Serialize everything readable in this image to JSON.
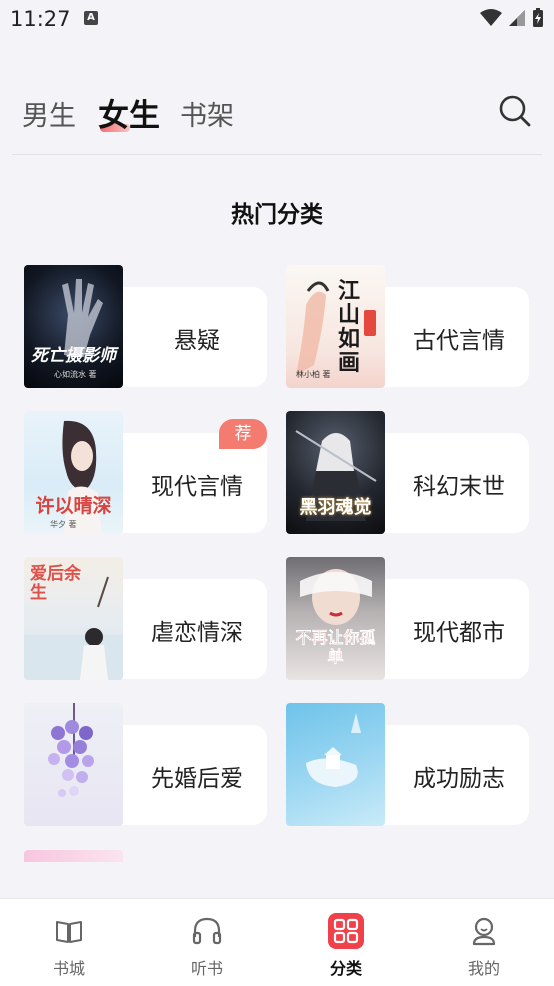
{
  "status_bar": {
    "time": "11:27",
    "notification_icon": "A"
  },
  "top_tabs": [
    {
      "label": "男生",
      "active": false
    },
    {
      "label": "女生",
      "active": true
    },
    {
      "label": "书架",
      "active": false
    }
  ],
  "section_title": "热门分类",
  "categories": [
    {
      "label": "悬疑",
      "cover_title": "死亡摄影师",
      "cover_author": "心如流水 著",
      "badge": ""
    },
    {
      "label": "古代言情",
      "cover_title": "江山如画",
      "cover_author": "林小柏 著",
      "badge": ""
    },
    {
      "label": "现代言情",
      "cover_title": "许以晴深",
      "cover_author": "华夕 著",
      "badge": "荐"
    },
    {
      "label": "科幻末世",
      "cover_title": "黑羽魂觉",
      "cover_author": "",
      "badge": ""
    },
    {
      "label": "虐恋情深",
      "cover_title": "爱后余生",
      "cover_author": "",
      "badge": ""
    },
    {
      "label": "现代都市",
      "cover_title": "不再让你孤单",
      "cover_author": "",
      "badge": ""
    },
    {
      "label": "先婚后爱",
      "cover_title": "",
      "cover_author": "",
      "badge": ""
    },
    {
      "label": "成功励志",
      "cover_title": "",
      "cover_author": "",
      "badge": ""
    }
  ],
  "bottom_nav": [
    {
      "label": "书城",
      "icon": "book-icon",
      "active": false
    },
    {
      "label": "听书",
      "icon": "headphones-icon",
      "active": false
    },
    {
      "label": "分类",
      "icon": "grid-icon",
      "active": true
    },
    {
      "label": "我的",
      "icon": "user-icon",
      "active": false
    }
  ],
  "colors": {
    "accent": "#f0404a",
    "badge": "#f47b6f",
    "background": "#f4f4f8"
  }
}
